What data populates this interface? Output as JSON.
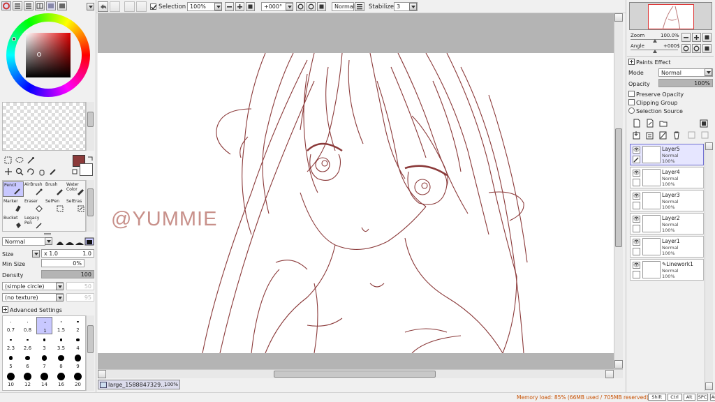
{
  "toolbar": {
    "selection_label": "Selection",
    "zoom_value": "100%",
    "angle_value": "+000°",
    "blend_mode": "Normal",
    "stabilizer_label": "Stabilizer",
    "stabilizer_value": "3"
  },
  "colors": {
    "primary": "#8b3a3a",
    "secondary": "#ffffff",
    "line": "#8b3a3a",
    "selected": "#c8c8ff",
    "status_text": "#c85000"
  },
  "tools": {
    "items": [
      {
        "label": "Pencil",
        "icon": "pencil-icon"
      },
      {
        "label": "AirBrush",
        "icon": "airbrush-icon"
      },
      {
        "label": "Brush",
        "icon": "brush-icon"
      },
      {
        "label": "Water Color",
        "icon": "watercolor-icon"
      },
      {
        "label": "Marker",
        "icon": "marker-icon"
      },
      {
        "label": "Eraser",
        "icon": "eraser-icon"
      },
      {
        "label": "SelPen",
        "icon": "selpen-icon"
      },
      {
        "label": "SelEras",
        "icon": "seleras-icon"
      },
      {
        "label": "Bucket",
        "icon": "bucket-icon"
      },
      {
        "label": "Legacy Pen",
        "icon": "legacy-pen-icon"
      }
    ]
  },
  "brush": {
    "blend_mode": "Normal",
    "size_label": "Size",
    "size_multiplier": "x 1.0",
    "size_value": "1.0",
    "min_size_label": "Min Size",
    "min_size_value": "0%",
    "density_label": "Density",
    "density_value": "100",
    "shape_value": "(simple circle)",
    "shape_amount": "50",
    "texture_value": "(no texture)",
    "texture_amount": "95",
    "advanced_label": "Advanced Settings",
    "sizes": [
      "0.7",
      "0.8",
      "1",
      "1.5",
      "2",
      "2.3",
      "2.6",
      "3",
      "3.5",
      "4",
      "5",
      "6",
      "7",
      "8",
      "9",
      "10",
      "12",
      "14",
      "16",
      "20"
    ]
  },
  "canvas": {
    "watermark": "@YUMMIE",
    "doc_tab": "large_1588847329...",
    "doc_zoom": "100%"
  },
  "navigator": {
    "zoom_label": "Zoom",
    "zoom_value": "100.0%",
    "angle_label": "Angle",
    "angle_value": "+000$"
  },
  "layer_panel": {
    "paints_effect": "Paints Effect",
    "mode_label": "Mode",
    "mode_value": "Normal",
    "opacity_label": "Opacity",
    "opacity_value": "100%",
    "preserve_opacity": "Preserve Opacity",
    "clipping_group": "Clipping Group",
    "selection_source": "Selection Source",
    "layers": [
      {
        "name": "Layer5",
        "mode": "Normal",
        "opacity": "100%"
      },
      {
        "name": "Layer4",
        "mode": "Normal",
        "opacity": "100%"
      },
      {
        "name": "Layer3",
        "mode": "Normal",
        "opacity": "100%"
      },
      {
        "name": "Layer2",
        "mode": "Normal",
        "opacity": "100%"
      },
      {
        "name": "Layer1",
        "mode": "Normal",
        "opacity": "100%"
      },
      {
        "name": "Linework1",
        "mode": "Normal",
        "opacity": "100%"
      }
    ]
  },
  "status": {
    "memory": "Memory load: 85% (66MB used / 705MB reserved)",
    "keys": [
      "Shift",
      "Ctrl",
      "Alt",
      "SPC",
      "Any"
    ]
  }
}
